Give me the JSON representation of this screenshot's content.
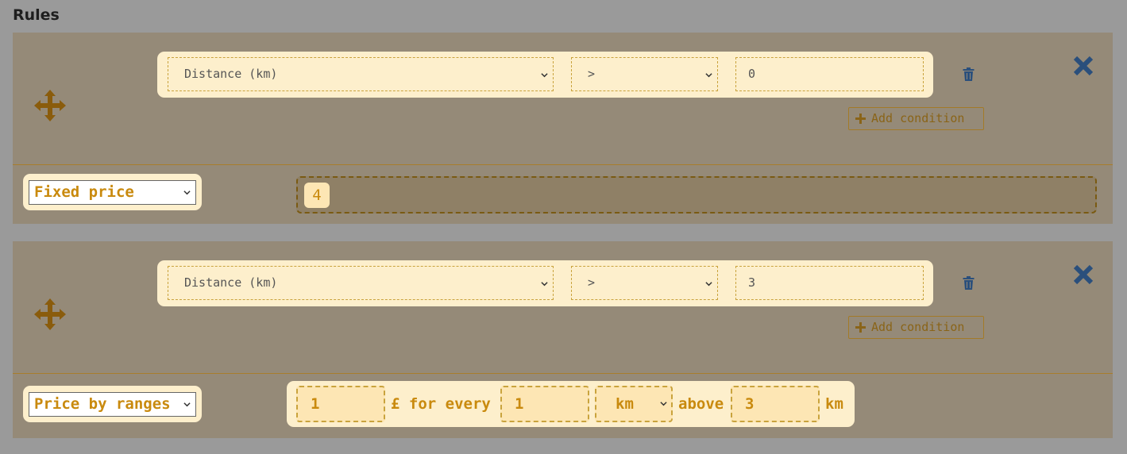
{
  "page": {
    "title": "Rules"
  },
  "rules": [
    {
      "condition": {
        "field": "Distance (km)",
        "operator": ">",
        "value": "0"
      },
      "add_condition_label": "Add condition",
      "price_type": "Fixed price",
      "fixed_value": "4"
    },
    {
      "condition": {
        "field": "Distance (km)",
        "operator": ">",
        "value": "3"
      },
      "add_condition_label": "Add condition",
      "price_type": "Price by ranges",
      "ranges": {
        "amount": "1",
        "currency_text": "£ for every",
        "step": "1",
        "unit": "km",
        "above_text": "above",
        "threshold": "3",
        "suffix_unit": "km"
      }
    }
  ],
  "icons": {
    "drag": "move-arrows-icon",
    "delete": "trash-icon",
    "remove": "close-x-icon",
    "add": "plus-icon",
    "dropdown": "chevron-down-icon"
  },
  "colors": {
    "accent": "#c98a0e",
    "panel": "#fdefcc",
    "rule_bg": "#958a78",
    "close": "#2a4f7c"
  }
}
